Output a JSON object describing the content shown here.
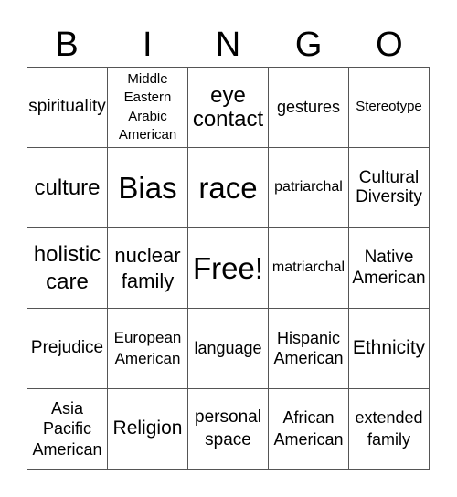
{
  "header": {
    "letters": [
      "B",
      "I",
      "N",
      "G",
      "O"
    ]
  },
  "card": {
    "rows": [
      [
        "spirituality",
        "Middle Eastern Arabic American",
        "eye contact",
        "gestures",
        "Stereotype"
      ],
      [
        "culture",
        "Bias",
        "race",
        "patriarchal",
        "Cultural Diversity"
      ],
      [
        "holistic care",
        "nuclear family",
        "Free!",
        "matriarchal",
        "Native American"
      ],
      [
        "Prejudice",
        "European American",
        "language",
        "Hispanic American",
        "Ethnicity"
      ],
      [
        "Asia Pacific American",
        "Religion",
        "personal space",
        "African American",
        "extended family"
      ]
    ]
  },
  "colors": {
    "grid_line": "#555555",
    "text": "#000000",
    "background": "#ffffff"
  }
}
